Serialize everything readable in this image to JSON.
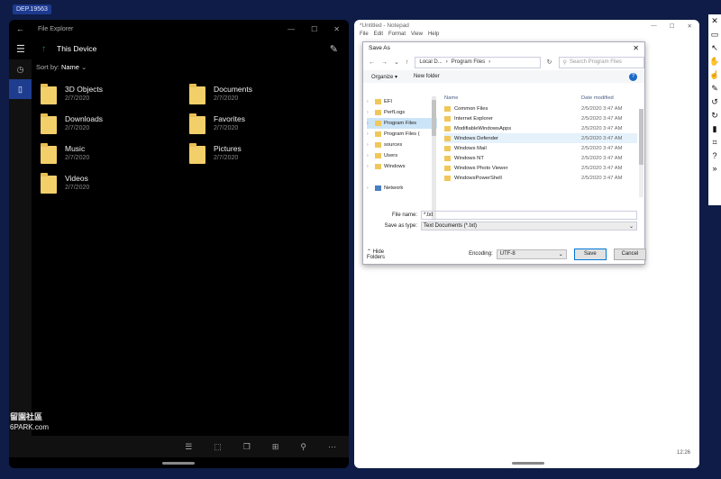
{
  "build_badge": "DEP.19563",
  "file_explorer": {
    "window_title": "File Explorer",
    "location": "This Device",
    "sort": {
      "label": "Sort by:",
      "value": "Name"
    },
    "folders": [
      {
        "name": "3D Objects",
        "date": "2/7/2020"
      },
      {
        "name": "Documents",
        "date": "2/7/2020"
      },
      {
        "name": "Downloads",
        "date": "2/7/2020"
      },
      {
        "name": "Favorites",
        "date": "2/7/2020"
      },
      {
        "name": "Music",
        "date": "2/7/2020"
      },
      {
        "name": "Pictures",
        "date": "2/7/2020"
      },
      {
        "name": "Videos",
        "date": "2/7/2020"
      }
    ]
  },
  "watermark": {
    "line1": "留園社區",
    "line2": "6PARK.com"
  },
  "notepad": {
    "window_title": "*Untitled - Notepad",
    "menu": [
      "File",
      "Edit",
      "Format",
      "View",
      "Help"
    ],
    "status_time": "12:26"
  },
  "save_as": {
    "title": "Save As",
    "address": [
      "Local D...",
      "Program Files"
    ],
    "search_placeholder": "Search Program Files",
    "organize": "Organize",
    "new_folder": "New folder",
    "tree": [
      {
        "label": "EFI",
        "selected": false
      },
      {
        "label": "PerfLogs",
        "selected": false
      },
      {
        "label": "Program Files",
        "selected": true
      },
      {
        "label": "Program Files (",
        "selected": false
      },
      {
        "label": "sources",
        "selected": false
      },
      {
        "label": "Users",
        "selected": false
      },
      {
        "label": "Windows",
        "selected": false
      },
      {
        "label": "Network",
        "selected": false
      }
    ],
    "columns": {
      "name": "Name",
      "date": "Date modified"
    },
    "rows": [
      {
        "name": "Common Files",
        "date": "2/5/2020 3:47 AM"
      },
      {
        "name": "Internet Explorer",
        "date": "2/5/2020 3:47 AM"
      },
      {
        "name": "ModifiableWindowsApps",
        "date": "2/5/2020 3:47 AM"
      },
      {
        "name": "Windows Defender",
        "date": "2/5/2020 3:47 AM"
      },
      {
        "name": "Windows Mail",
        "date": "2/5/2020 3:47 AM"
      },
      {
        "name": "Windows NT",
        "date": "2/5/2020 3:47 AM"
      },
      {
        "name": "Windows Photo Viewer",
        "date": "2/5/2020 3:47 AM"
      },
      {
        "name": "WindowsPowerShell",
        "date": "2/5/2020 3:47 AM"
      }
    ],
    "file_name_label": "File name:",
    "file_name_value": "*.txt",
    "save_type_label": "Save as type:",
    "save_type_value": "Text Documents (*.txt)",
    "hide_folders": "Hide Folders",
    "encoding_label": "Encoding:",
    "encoding_value": "UTF-8",
    "save_button": "Save",
    "cancel_button": "Cancel"
  }
}
